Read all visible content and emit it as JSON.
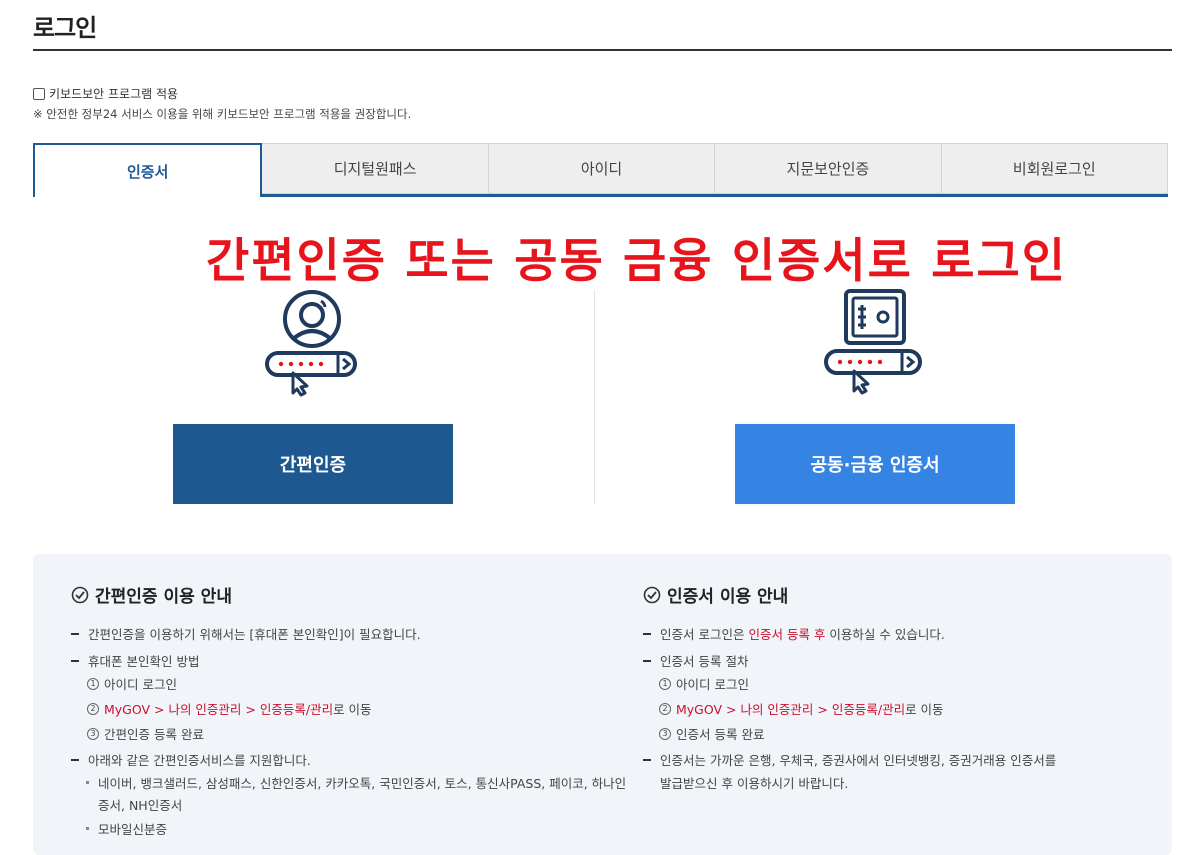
{
  "page": {
    "title": "로그인"
  },
  "keyboard_security": {
    "label": "키보드보안 프로그램 적용",
    "checked": false,
    "note": "※ 안전한 정부24 서비스 이용을 위해 키보드보안 프로그램 적용을 권장합니다."
  },
  "tabs": [
    {
      "label": "인증서",
      "active": true
    },
    {
      "label": "디지털원패스",
      "active": false
    },
    {
      "label": "아이디",
      "active": false
    },
    {
      "label": "지문보안인증",
      "active": false
    },
    {
      "label": "비회원로그인",
      "active": false
    }
  ],
  "overlay_caption": "간편인증 또는 공동 금융 인증서로 로그인",
  "buttons": {
    "simple_auth": "간편인증",
    "joint_cert": "공동·금융 인증서"
  },
  "guide": {
    "simple": {
      "heading": "간편인증 이용 안내",
      "line1": "간편인증을 이용하기 위해서는 [휴대폰 본인확인]이 필요합니다.",
      "line2": "휴대폰 본인확인 방법",
      "step1_num": "1",
      "step1": "아이디 로그인",
      "step2_num": "2",
      "step2_link": "MyGOV > 나의 인증관리 > 인증등록/관리",
      "step2_suffix": "로 이동",
      "step3_num": "3",
      "step3": "간편인증 등록 완료",
      "line3": "아래와 같은 간편인증서비스를 지원합니다.",
      "providers_a": "네이버, 뱅크샐러드, 삼성패스, 신한인증서, 카카오톡, 국민인증서, 토스, 통신사PASS, 페이코, 하나인",
      "providers_b": "증서, NH인증서",
      "mobile_id": "모바일신분증"
    },
    "cert": {
      "heading": "인증서 이용 안내",
      "line1_prefix": "인증서 로그인은 ",
      "line1_red": "인증서 등록 후",
      "line1_suffix": " 이용하실 수 있습니다.",
      "line2": "인증서 등록 절차",
      "step1_num": "1",
      "step1": "아이디 로그인",
      "step2_num": "2",
      "step2_link": "MyGOV > 나의 인증관리 > 인증등록/관리",
      "step2_suffix": "로 이동",
      "step3_num": "3",
      "step3": "인증서 등록 완료",
      "line3a": "인증서는 가까운 은행, 우체국, 증권사에서 인터넷뱅킹, 증권거래용 인증서를",
      "line3b": "발급받으신 후 이용하시기 바랍니다."
    }
  },
  "colors": {
    "primary_navy": "#1d5891",
    "primary_blue": "#3584e4",
    "overlay_red": "#e8141b",
    "link_red": "#c8102e",
    "guide_bg": "#f1f4f8"
  },
  "icons": {
    "simple_auth": "person-password-icon",
    "joint_cert": "safe-password-icon",
    "guide_heading": "check-circle-icon"
  }
}
